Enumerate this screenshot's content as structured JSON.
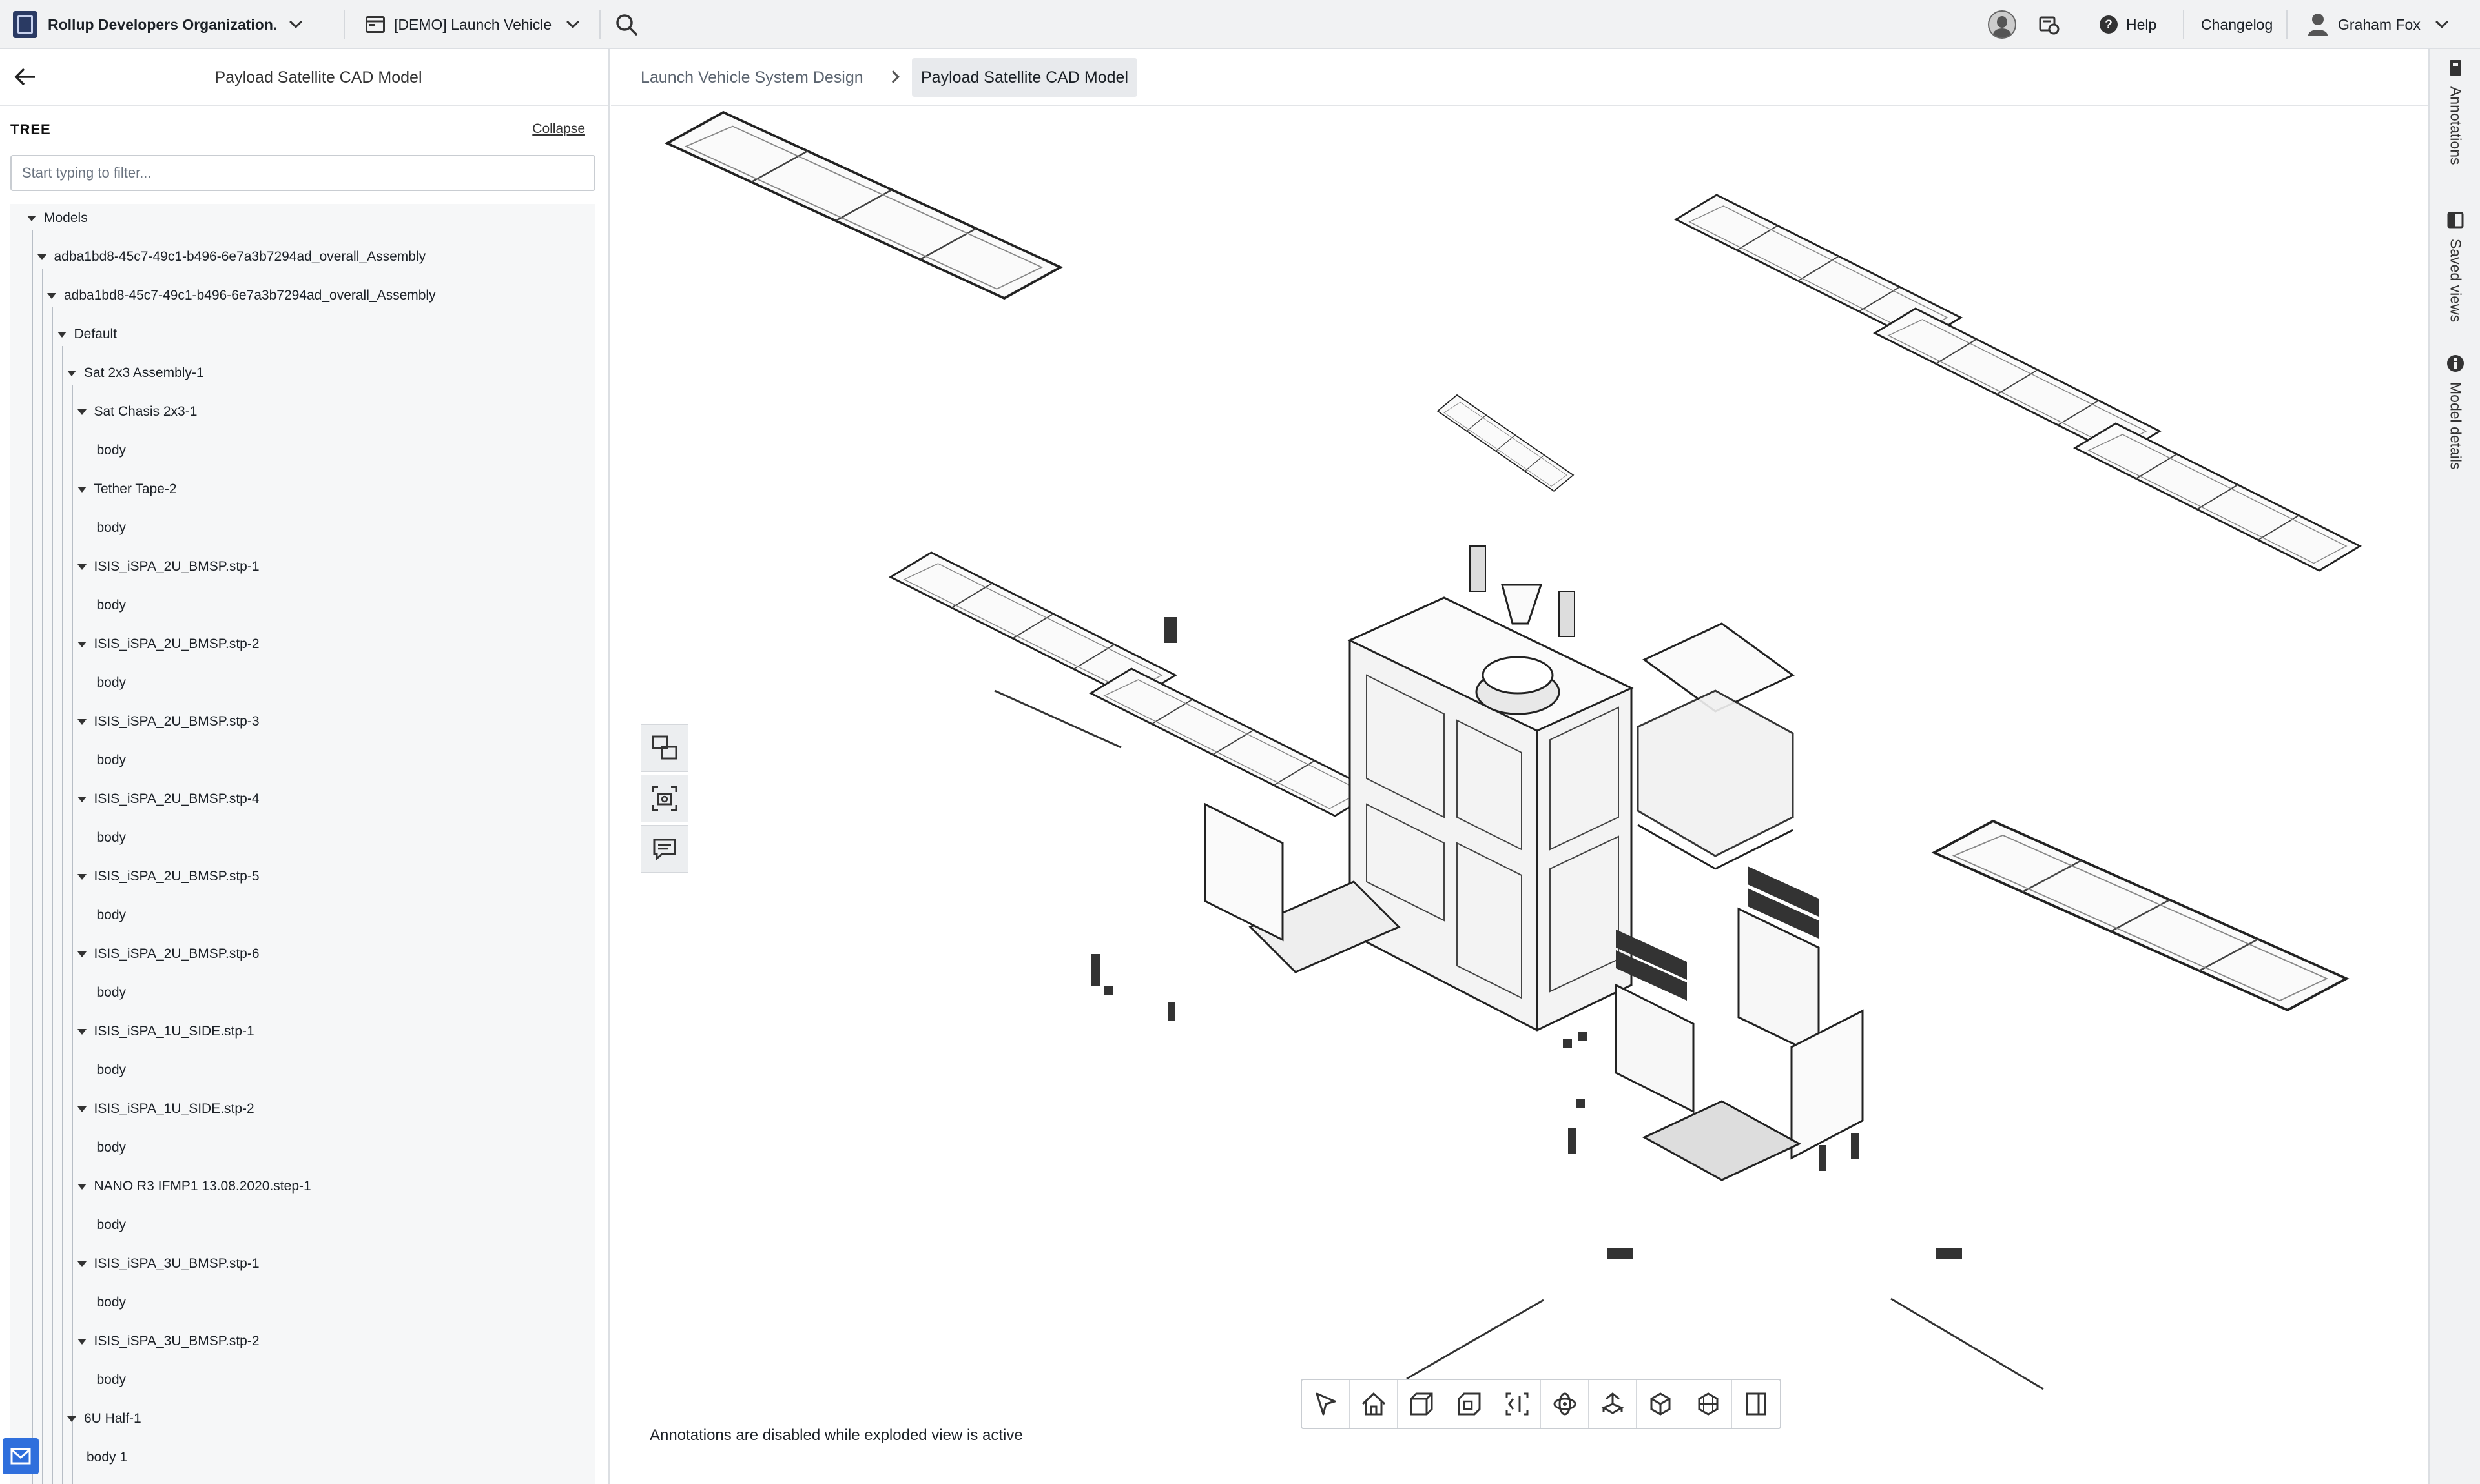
{
  "topbar": {
    "org_name": "Rollup Developers Organization.",
    "project_name": "[DEMO] Launch Vehicle",
    "help_label": "Help",
    "changelog_label": "Changelog",
    "user_name": "Graham Fox"
  },
  "left_panel": {
    "title": "Payload Satellite CAD Model",
    "tree_label": "TREE",
    "collapse_label": "Collapse",
    "filter_placeholder": "Start typing to filter...",
    "nodes": [
      {
        "label": "Models"
      },
      {
        "label": "adba1bd8-45c7-49c1-b496-6e7a3b7294ad_overall_Assembly"
      },
      {
        "label": "adba1bd8-45c7-49c1-b496-6e7a3b7294ad_overall_Assembly"
      },
      {
        "label": "Default"
      },
      {
        "label": "Sat 2x3 Assembly-1"
      },
      {
        "label": "Sat Chasis 2x3-1"
      },
      {
        "label": "body"
      },
      {
        "label": "Tether Tape-2"
      },
      {
        "label": "body"
      },
      {
        "label": "ISIS_iSPA_2U_BMSP.stp-1"
      },
      {
        "label": "body"
      },
      {
        "label": "ISIS_iSPA_2U_BMSP.stp-2"
      },
      {
        "label": "body"
      },
      {
        "label": "ISIS_iSPA_2U_BMSP.stp-3"
      },
      {
        "label": "body"
      },
      {
        "label": "ISIS_iSPA_2U_BMSP.stp-4"
      },
      {
        "label": "body"
      },
      {
        "label": "ISIS_iSPA_2U_BMSP.stp-5"
      },
      {
        "label": "body"
      },
      {
        "label": "ISIS_iSPA_2U_BMSP.stp-6"
      },
      {
        "label": "body"
      },
      {
        "label": "ISIS_iSPA_1U_SIDE.stp-1"
      },
      {
        "label": "body"
      },
      {
        "label": "ISIS_iSPA_1U_SIDE.stp-2"
      },
      {
        "label": "body"
      },
      {
        "label": "NANO R3 IFMP1 13.08.2020.step-1"
      },
      {
        "label": "body"
      },
      {
        "label": "ISIS_iSPA_3U_BMSP.stp-1"
      },
      {
        "label": "body"
      },
      {
        "label": "ISIS_iSPA_3U_BMSP.stp-2"
      },
      {
        "label": "body"
      },
      {
        "label": "6U Half-1"
      },
      {
        "label": "body 1"
      }
    ]
  },
  "breadcrumb": {
    "parent": "Launch Vehicle System Design",
    "current": "Payload Satellite CAD Model"
  },
  "viewer": {
    "annotations_message": "Annotations are disabled while exploded view is active",
    "bottom_tools": [
      "select-pointer-icon",
      "home-icon",
      "cube-front-icon",
      "cube-iso-icon",
      "fit-view-icon",
      "orbit-icon",
      "explode-icon",
      "box-3d-icon",
      "section-grid-icon",
      "split-panel-icon"
    ],
    "side_tools": [
      "screenshot-compare-icon",
      "camera-icon",
      "comment-icon"
    ]
  },
  "right_sidebar": {
    "tabs": [
      "Annotations",
      "Saved views",
      "Model details"
    ]
  }
}
